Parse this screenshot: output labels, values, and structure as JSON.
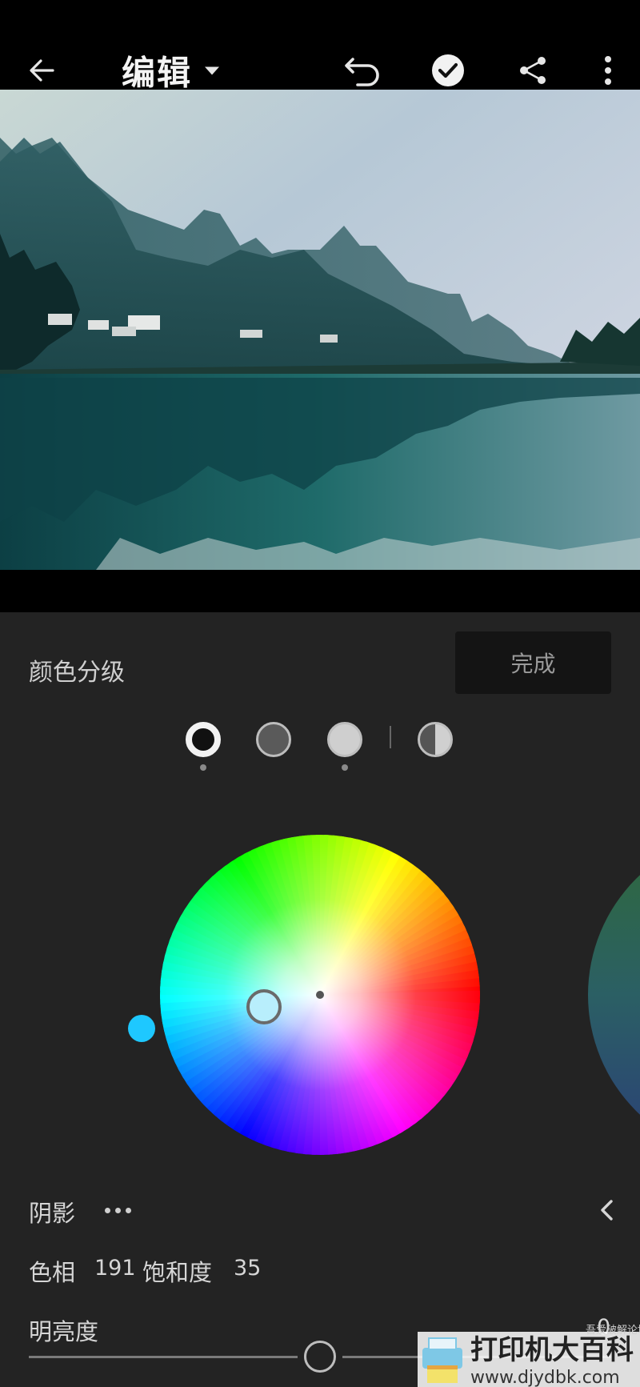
{
  "toolbar": {
    "title": "编辑",
    "icons": {
      "back": "arrow-left-icon",
      "title_dropdown": "caret-down-icon",
      "undo": "undo-icon",
      "confirm": "check-circle-icon",
      "share": "share-icon",
      "more": "more-vertical-icon"
    }
  },
  "panel": {
    "title": "颜色分级",
    "done_label": "完成",
    "tones": [
      {
        "name": "shadows",
        "selected": true,
        "has_adjustment": true
      },
      {
        "name": "midtones",
        "selected": false,
        "has_adjustment": false
      },
      {
        "name": "highlights",
        "selected": false,
        "has_adjustment": true
      },
      {
        "name": "global",
        "selected": false,
        "has_adjustment": false
      }
    ],
    "region_label": "阴影",
    "hue_label": "色相",
    "hue_value": "191",
    "saturation_label": "饱和度",
    "saturation_value": "35",
    "luminance_label": "明亮度",
    "luminance_value": "0",
    "luminance_level": 0
  },
  "colors": {
    "accent": "#1ec8ff",
    "panel_bg": "#232323",
    "done_bg": "#141414"
  },
  "watermark": {
    "text": "打印机大百科",
    "url": "www.djydbk.com",
    "sub": "吾爱破解论坛"
  }
}
